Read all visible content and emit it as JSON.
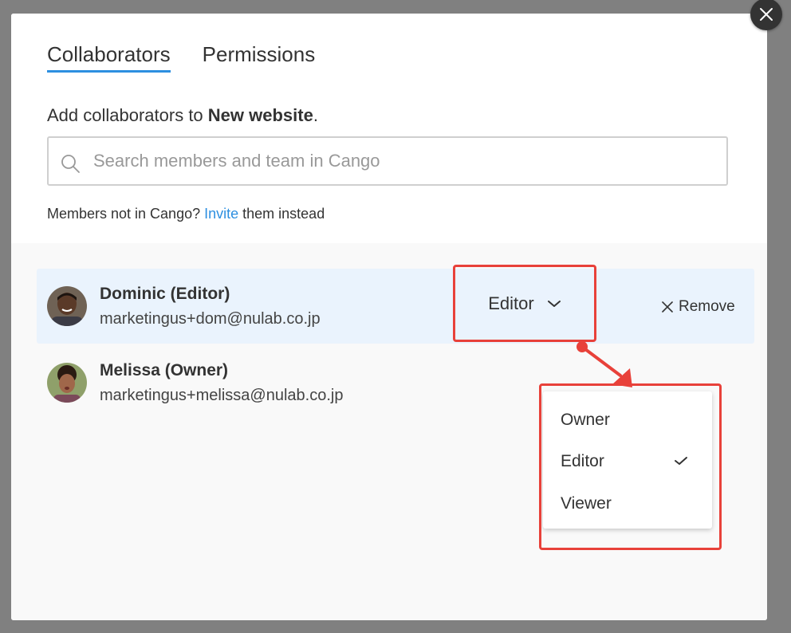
{
  "dialog": {
    "tabs": [
      {
        "label": "Collaborators",
        "active": true
      },
      {
        "label": "Permissions",
        "active": false
      }
    ],
    "intro_prefix": "Add collaborators to ",
    "intro_project": "New website",
    "intro_suffix": ".",
    "search": {
      "placeholder": "Search members and team in Cango",
      "value": ""
    },
    "invite_note": {
      "prefix": "Members not in Cango? ",
      "link": "Invite",
      "suffix": " them instead"
    }
  },
  "collaborators": [
    {
      "name": "Dominic (Editor)",
      "email": "marketingus+dom@nulab.co.jp",
      "role": "Editor",
      "remove_label": "Remove"
    },
    {
      "name": "Melissa (Owner)",
      "email": "marketingus+melissa@nulab.co.jp"
    }
  ],
  "role_dropdown": {
    "options": [
      "Owner",
      "Editor",
      "Viewer"
    ],
    "selected": "Editor"
  },
  "colors": {
    "accent": "#2d8fe0",
    "annotation": "#e8413a",
    "row_highlight": "#eaf3fd"
  },
  "icons": [
    "close-icon",
    "search-icon",
    "chevron-down-icon",
    "x-icon",
    "check-icon"
  ]
}
